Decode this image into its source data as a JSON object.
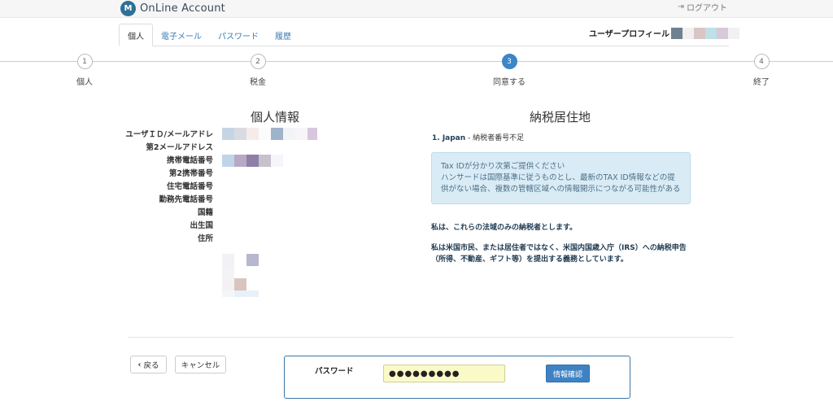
{
  "header": {
    "logo_mark": "M",
    "app_title": "OnLine Account",
    "logout_label": "ログアウト"
  },
  "tabs": [
    "個人",
    "電子メール",
    "パスワード",
    "履歴"
  ],
  "profile_label": "ユーザープロフィール",
  "steps": [
    {
      "number": "1",
      "label": "個人"
    },
    {
      "number": "2",
      "label": "税金"
    },
    {
      "number": "3",
      "label": "同意する"
    },
    {
      "number": "4",
      "label": "終了"
    }
  ],
  "active_step": 3,
  "personal": {
    "title": "個人情報",
    "fields": [
      "ユーザＩＤ/メールアドレ",
      "第2メールアドレス",
      "携帯電話番号",
      "第2携帯番号",
      "住宅電話番号",
      "勤務先電話番号",
      "国籍",
      "出生国",
      "住所"
    ]
  },
  "tax": {
    "title": "納税居住地",
    "residence_country": "1. Japan",
    "residence_note": " - 納税者番号不足",
    "info_title": "Tax IDが分かり次第ご提供ください",
    "info_body": "ハンサードは国際基準に従うものとし、最新のTAX ID情報などの提供がない場合、複数の管轄区域への情報開示につながる可能性がある",
    "statement1": "私は、これらの法域のみの納税者とします。",
    "statement2": "私は米国市民、または居住者ではなく、米国内国歳入庁（IRS）への納税申告（所得、不動産、ギフト等）を提出する義務としています。"
  },
  "actions": {
    "back_icon": "chevron-left-icon",
    "back_label": "戻る",
    "cancel_label": "キャンセル",
    "password_label": "パスワード",
    "password_value": "●●●●●●●●●",
    "confirm_label": "情報確認"
  },
  "colors": {
    "accent": "#3a86c6",
    "info_bg": "#d9ecf6",
    "password_bg": "#fafac8"
  }
}
